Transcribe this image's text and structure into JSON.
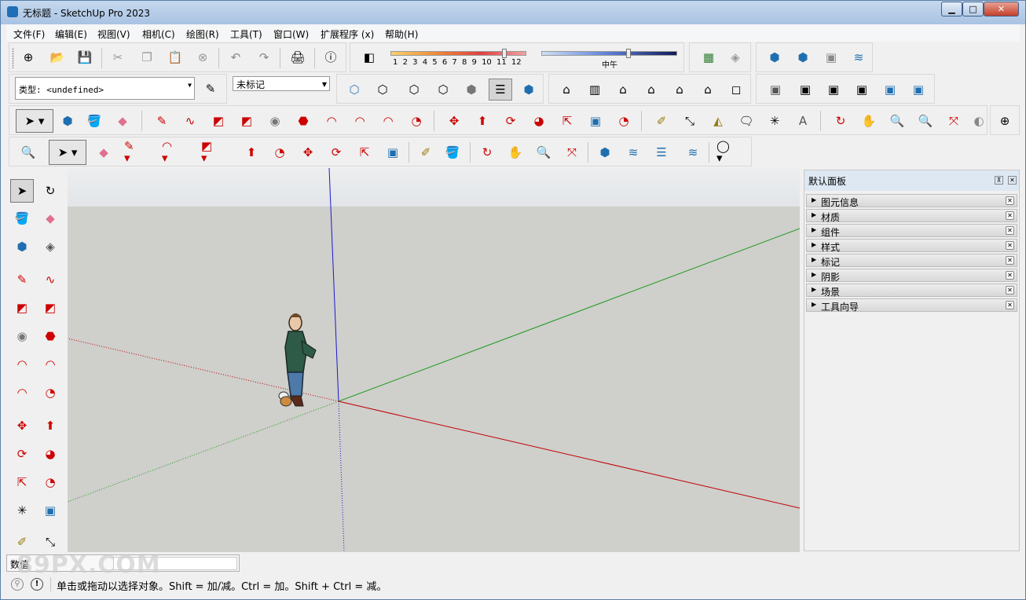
{
  "window": {
    "title": "无标题 - SketchUp Pro 2023"
  },
  "menu": [
    "文件(F)",
    "编辑(E)",
    "视图(V)",
    "相机(C)",
    "绘图(R)",
    "工具(T)",
    "窗口(W)",
    "扩展程序 (x)",
    "帮助(H)"
  ],
  "shadow": {
    "time_labels": [
      "1",
      "2",
      "3",
      "4",
      "5",
      "6",
      "7",
      "8",
      "9",
      "10",
      "11",
      "12"
    ],
    "noon_label": "中午"
  },
  "entity": {
    "type_label": "类型:",
    "type_value": "<undefined>"
  },
  "tag": {
    "value": "未标记"
  },
  "tray": {
    "title": "默认面板",
    "panels": [
      "图元信息",
      "材质",
      "组件",
      "样式",
      "标记",
      "阴影",
      "场景",
      "工具向导"
    ]
  },
  "vcb": {
    "label": "数值"
  },
  "status": {
    "message": "单击或拖动以选择对象。Shift = 加/减。Ctrl = 加。Shift + Ctrl = 减。"
  },
  "watermark": "89PX.COM",
  "colors": {
    "red_axis": "#c00000",
    "green_axis": "#1a9a1a",
    "blue_axis": "#1a1acc",
    "accent": "#d21f1f"
  }
}
